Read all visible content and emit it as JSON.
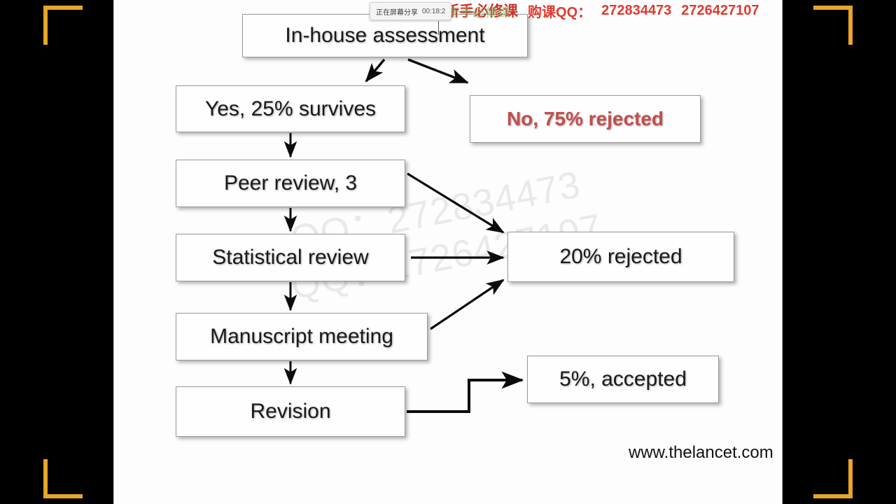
{
  "overlay": {
    "share_label": "正在屏幕分享",
    "share_time": "00:18:2",
    "promo_course": "SCI新手必修课",
    "promo_course_shadow": "SCI新手必修课",
    "promo_buy_label": "购课QQ：",
    "promo_qq_1": "272834473",
    "promo_qq_2": "2726427107",
    "accent_red": "#e03a2f",
    "accent_green": "#7fc46a",
    "frame_color": "#e8a52a"
  },
  "watermark": {
    "line1": "QQ：272834473",
    "line2": "QQ：2726427107"
  },
  "slide": {
    "source_url": "www.thelancet.com",
    "reject_color": "#c0504d",
    "nodes": [
      {
        "id": "inhouse",
        "label": "In-house assessment"
      },
      {
        "id": "yes",
        "label": "Yes, 25% survives"
      },
      {
        "id": "no",
        "label": "No, 75% rejected"
      },
      {
        "id": "peer",
        "label": "Peer review, 3"
      },
      {
        "id": "stat",
        "label": "Statistical review"
      },
      {
        "id": "manu",
        "label": "Manuscript meeting"
      },
      {
        "id": "rev",
        "label": "Revision"
      },
      {
        "id": "rej20",
        "label": "20% rejected"
      },
      {
        "id": "acc5",
        "label": "5%, accepted"
      }
    ],
    "edges": [
      {
        "from": "inhouse",
        "to": "yes",
        "style": "diagonal-arrow"
      },
      {
        "from": "inhouse",
        "to": "no",
        "style": "diagonal-arrow"
      },
      {
        "from": "yes",
        "to": "peer",
        "style": "vertical-arrow"
      },
      {
        "from": "peer",
        "to": "stat",
        "style": "vertical-arrow"
      },
      {
        "from": "peer",
        "to": "rej20",
        "style": "diagonal-arrow"
      },
      {
        "from": "stat",
        "to": "manu",
        "style": "vertical-arrow"
      },
      {
        "from": "stat",
        "to": "rej20",
        "style": "horizontal-arrow"
      },
      {
        "from": "manu",
        "to": "rev",
        "style": "vertical-arrow"
      },
      {
        "from": "manu",
        "to": "rej20",
        "style": "diagonal-arrow"
      },
      {
        "from": "rev",
        "to": "acc5",
        "style": "elbow-arrow"
      }
    ]
  }
}
